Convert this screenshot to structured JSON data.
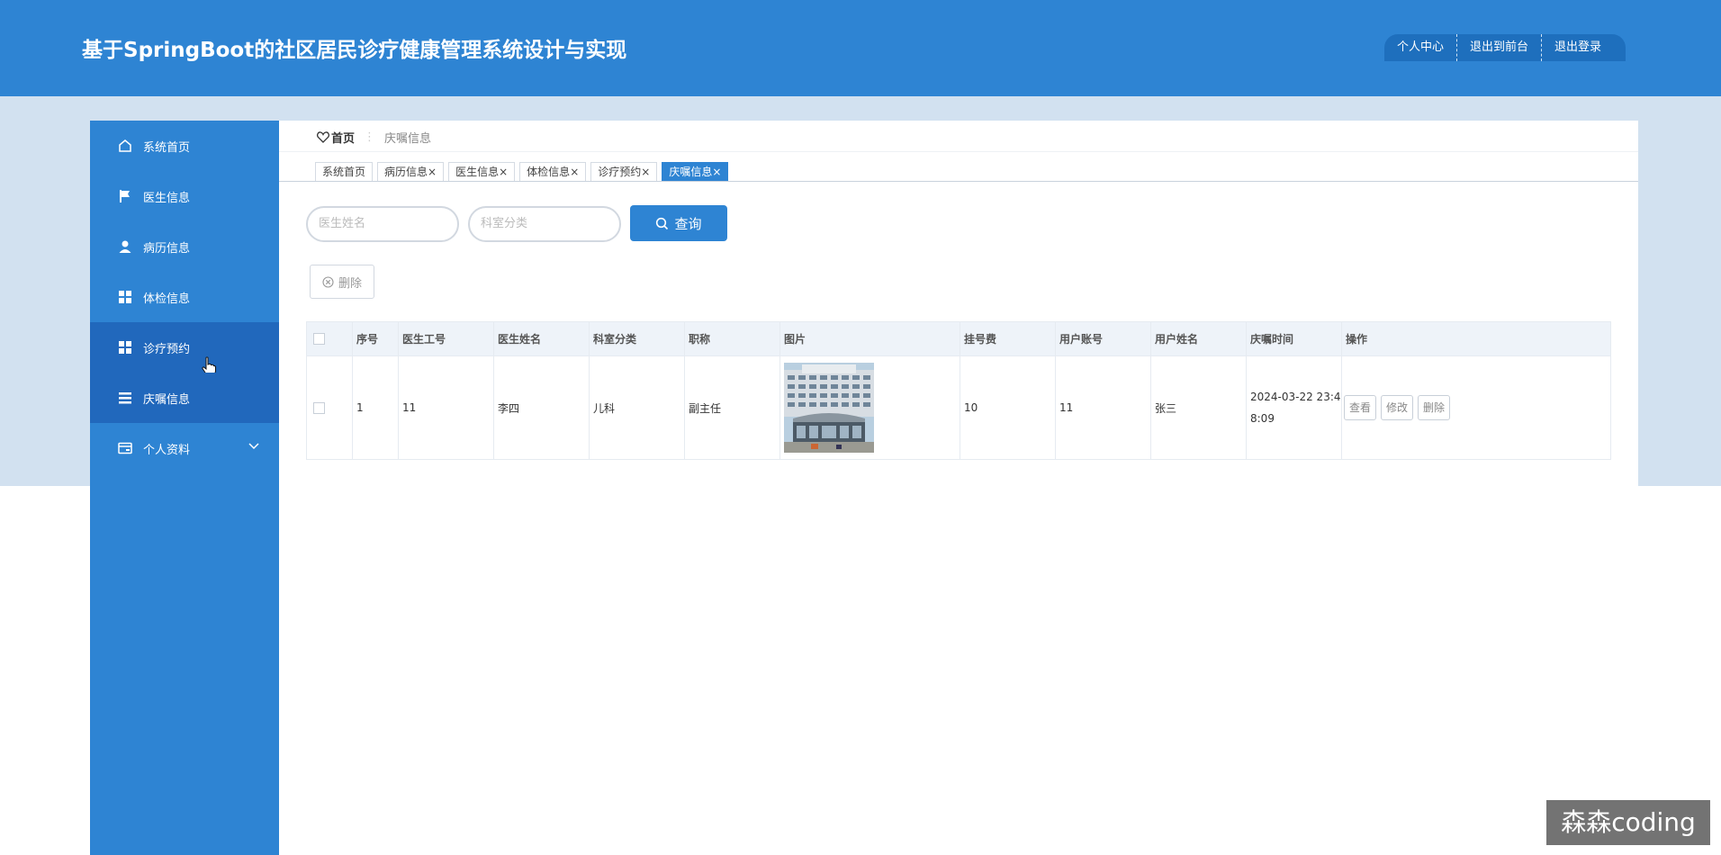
{
  "header": {
    "title": "基于SpringBoot的社区居民诊疗健康管理系统设计与实现",
    "actions": [
      "个人中心",
      "退出到前台",
      "退出登录"
    ]
  },
  "sidebar": {
    "items": [
      {
        "label": "系统首页",
        "icon": "home-icon"
      },
      {
        "label": "医生信息",
        "icon": "flag-icon"
      },
      {
        "label": "病历信息",
        "icon": "user-icon"
      },
      {
        "label": "体检信息",
        "icon": "grid-icon"
      },
      {
        "label": "诊疗预约",
        "icon": "grid-icon"
      },
      {
        "label": "庆嘱信息",
        "icon": "list-icon"
      },
      {
        "label": "个人资料",
        "icon": "card-icon"
      }
    ]
  },
  "breadcrumb": {
    "home": "首页",
    "current": "庆嘱信息"
  },
  "tabs": [
    {
      "label": "系统首页"
    },
    {
      "label": "病历信息",
      "close": "×"
    },
    {
      "label": "医生信息",
      "close": "×"
    },
    {
      "label": "体检信息",
      "close": "×"
    },
    {
      "label": "诊疗预约",
      "close": "×"
    },
    {
      "label": "庆嘱信息",
      "close": "×"
    }
  ],
  "search": {
    "doctor_name_placeholder": "医生姓名",
    "department_placeholder": "科室分类",
    "query_label": "查询"
  },
  "toolbar": {
    "delete_label": "删除"
  },
  "table": {
    "columns": [
      "序号",
      "医生工号",
      "医生姓名",
      "科室分类",
      "职称",
      "图片",
      "挂号费",
      "用户账号",
      "用户姓名",
      "庆嘱时间",
      "操作"
    ],
    "rows": [
      {
        "index": "1",
        "doctor_id": "11",
        "doctor_name": "李四",
        "department": "儿科",
        "title": "副主任",
        "fee": "10",
        "account": "11",
        "user_name": "张三",
        "time_line1": "2024-03-22 23:4",
        "time_line2": "8:09",
        "ops": [
          "查看",
          "修改",
          "删除"
        ]
      }
    ]
  },
  "watermark": "森森coding",
  "colors": {
    "primary": "#2e84d3",
    "active": "#2168bc",
    "band": "#d2e1f0"
  }
}
